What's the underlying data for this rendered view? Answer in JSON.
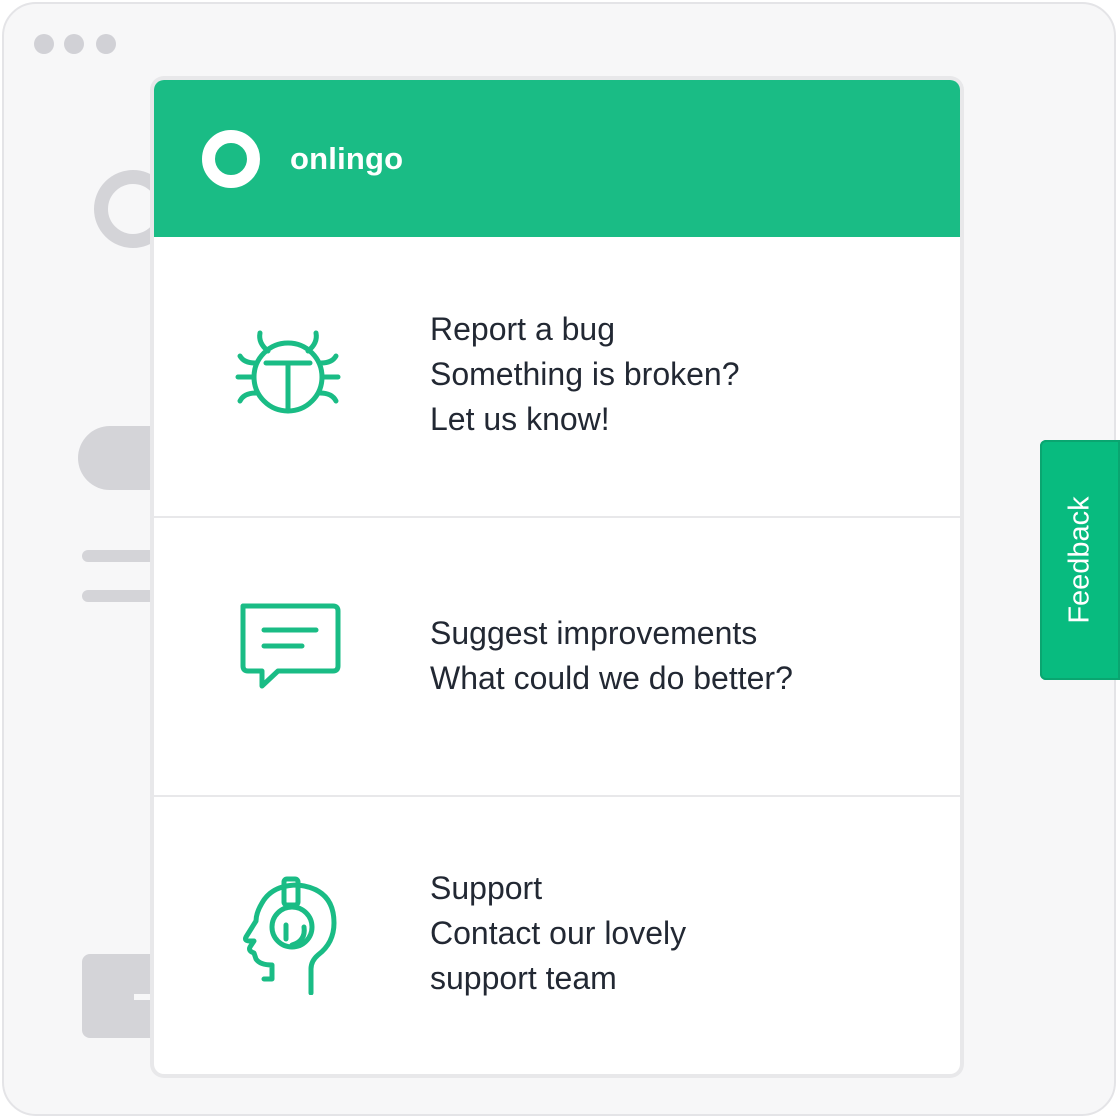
{
  "brand": {
    "name": "onlingo",
    "color": "#1abc85"
  },
  "options": [
    {
      "title": "Report a bug",
      "lines": [
        "Something is broken?",
        "Let us know!"
      ],
      "icon": "bug-icon"
    },
    {
      "title": "Suggest improvements",
      "lines": [
        "What could we do better?"
      ],
      "icon": "chat-bubble-icon"
    },
    {
      "title": "Support",
      "lines": [
        "Contact our lovely",
        "support team"
      ],
      "icon": "headset-agent-icon"
    }
  ],
  "feedback_tab": {
    "label": "Feedback",
    "color": "#08bb7f"
  },
  "window_controls": [
    "dot-icon",
    "dot-icon",
    "dot-icon"
  ]
}
